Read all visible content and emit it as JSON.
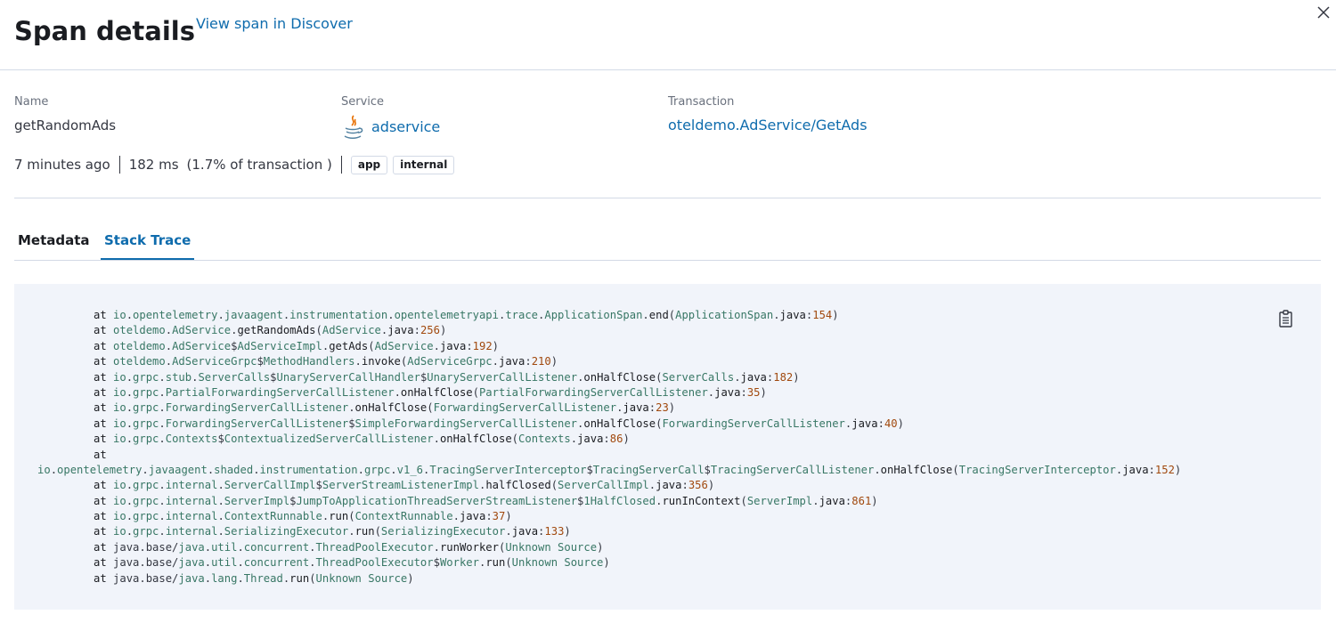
{
  "header": {
    "title": "Span details",
    "discover_link": "View span in Discover"
  },
  "summary": {
    "name_label": "Name",
    "name_value": "getRandomAds",
    "service_label": "Service",
    "service_value": "adservice",
    "transaction_label": "Transaction",
    "transaction_value": "oteldemo.AdService/GetAds",
    "time_ago": "7 minutes ago",
    "duration": "182 ms",
    "percent": "(1.7% of transaction )",
    "badges": [
      "app",
      "internal"
    ]
  },
  "tabs": [
    "Metadata",
    "Stack Trace"
  ],
  "stack_trace": [
    {
      "at": "at",
      "cls": "io.opentelemetry.javaagent.instrumentation.opentelemetryapi.trace.ApplicationSpan",
      "method": "end",
      "file": "ApplicationSpan",
      "ext": "java",
      "line": "154",
      "wrap": false
    },
    {
      "at": "at",
      "cls": "oteldemo.AdService",
      "method": "getRandomAds",
      "file": "AdService",
      "ext": "java",
      "line": "256",
      "wrap": false
    },
    {
      "at": "at",
      "cls": "oteldemo.AdService$AdServiceImpl",
      "method": "getAds",
      "file": "AdService",
      "ext": "java",
      "line": "192",
      "wrap": false
    },
    {
      "at": "at",
      "cls": "oteldemo.AdServiceGrpc$MethodHandlers",
      "method": "invoke",
      "file": "AdServiceGrpc",
      "ext": "java",
      "line": "210",
      "wrap": false
    },
    {
      "at": "at",
      "cls": "io.grpc.stub.ServerCalls$UnaryServerCallHandler$UnaryServerCallListener",
      "method": "onHalfClose",
      "file": "ServerCalls",
      "ext": "java",
      "line": "182",
      "wrap": false
    },
    {
      "at": "at",
      "cls": "io.grpc.PartialForwardingServerCallListener",
      "method": "onHalfClose",
      "file": "PartialForwardingServerCallListener",
      "ext": "java",
      "line": "35",
      "wrap": false
    },
    {
      "at": "at",
      "cls": "io.grpc.ForwardingServerCallListener",
      "method": "onHalfClose",
      "file": "ForwardingServerCallListener",
      "ext": "java",
      "line": "23",
      "wrap": false
    },
    {
      "at": "at",
      "cls": "io.grpc.ForwardingServerCallListener$SimpleForwardingServerCallListener",
      "method": "onHalfClose",
      "file": "ForwardingServerCallListener",
      "ext": "java",
      "line": "40",
      "wrap": false
    },
    {
      "at": "at",
      "cls": "io.grpc.Contexts$ContextualizedServerCallListener",
      "method": "onHalfClose",
      "file": "Contexts",
      "ext": "java",
      "line": "86",
      "wrap": false
    },
    {
      "at": "at",
      "cls": "io.opentelemetry.javaagent.shaded.instrumentation.grpc.v1_6.TracingServerInterceptor$TracingServerCall$TracingServerCallListener",
      "method": "onHalfClose",
      "file": "TracingServerInterceptor",
      "ext": "java",
      "line": "152",
      "wrap": true
    },
    {
      "at": "at",
      "cls": "io.grpc.internal.ServerCallImpl$ServerStreamListenerImpl",
      "method": "halfClosed",
      "file": "ServerCallImpl",
      "ext": "java",
      "line": "356",
      "wrap": false
    },
    {
      "at": "at",
      "cls": "io.grpc.internal.ServerImpl$JumpToApplicationThreadServerStreamListener$1HalfClosed",
      "method": "runInContext",
      "file": "ServerImpl",
      "ext": "java",
      "line": "861",
      "wrap": false
    },
    {
      "at": "at",
      "cls": "io.grpc.internal.ContextRunnable",
      "method": "run",
      "file": "ContextRunnable",
      "ext": "java",
      "line": "37",
      "wrap": false
    },
    {
      "at": "at",
      "cls": "io.grpc.internal.SerializingExecutor",
      "method": "run",
      "file": "SerializingExecutor",
      "ext": "java",
      "line": "133",
      "wrap": false
    },
    {
      "at": "at",
      "cls": "java.base/java.util.concurrent.ThreadPoolExecutor",
      "method": "runWorker",
      "file": "Unknown Source",
      "ext": "",
      "line": "",
      "wrap": false
    },
    {
      "at": "at",
      "cls": "java.base/java.util.concurrent.ThreadPoolExecutor$Worker",
      "method": "run",
      "file": "Unknown Source",
      "ext": "",
      "line": "",
      "wrap": false
    },
    {
      "at": "at",
      "cls": "java.base/java.lang.Thread",
      "method": "run",
      "file": "Unknown Source",
      "ext": "",
      "line": "",
      "wrap": false
    }
  ],
  "icons": {
    "close": "close-icon",
    "service": "java-icon",
    "copy": "copy-clipboard-icon"
  },
  "colors": {
    "link": "#0f6cad",
    "code_bg": "#f1f4fa",
    "code_class": "#387765",
    "code_number": "#a1490e"
  }
}
